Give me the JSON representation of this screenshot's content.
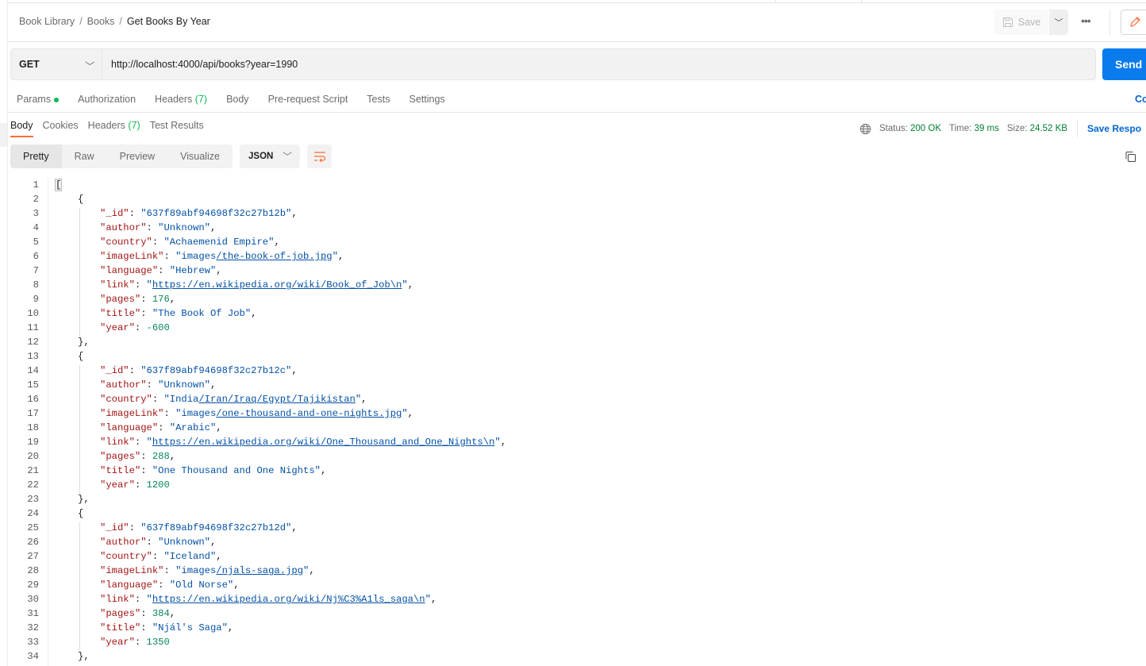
{
  "breadcrumb": {
    "items": [
      "Book Library",
      "Books"
    ],
    "current": "Get Books By Year"
  },
  "toolbar": {
    "save_label": "Save",
    "more_label": "•••"
  },
  "request": {
    "method": "GET",
    "url": "http://localhost:4000/api/books?year=1990",
    "send_label": "Send",
    "tabs": [
      {
        "label": "Params",
        "dot": true
      },
      {
        "label": "Authorization"
      },
      {
        "label": "Headers",
        "count": "(7)"
      },
      {
        "label": "Body"
      },
      {
        "label": "Pre-request Script"
      },
      {
        "label": "Tests"
      },
      {
        "label": "Settings"
      }
    ],
    "cookies_label": "Co"
  },
  "response": {
    "tabs": [
      {
        "label": "Body",
        "active": true
      },
      {
        "label": "Cookies"
      },
      {
        "label": "Headers",
        "count": "(7)"
      },
      {
        "label": "Test Results"
      }
    ],
    "status_label": "Status:",
    "status": "200 OK",
    "time_label": "Time:",
    "time": "39 ms",
    "size_label": "Size:",
    "size": "24.52 KB",
    "save_response_label": "Save Respo",
    "views": [
      "Pretty",
      "Raw",
      "Preview",
      "Visualize"
    ],
    "active_view": "Pretty",
    "format": "JSON",
    "books": [
      {
        "_id": "637f89abf94698f32c27b12b",
        "author": "Unknown",
        "country": "Achaemenid Empire",
        "imageLink": "images/the-book-of-job.jpg",
        "language": "Hebrew",
        "link": "https://en.wikipedia.org/wiki/Book_of_Job\\n",
        "pages": 176,
        "title": "The Book Of Job",
        "year": -600
      },
      {
        "_id": "637f89abf94698f32c27b12c",
        "author": "Unknown",
        "country": "India/Iran/Iraq/Egypt/Tajikistan",
        "imageLink": "images/one-thousand-and-one-nights.jpg",
        "language": "Arabic",
        "link": "https://en.wikipedia.org/wiki/One_Thousand_and_One_Nights\\n",
        "pages": 288,
        "title": "One Thousand and One Nights",
        "year": 1200
      },
      {
        "_id": "637f89abf94698f32c27b12d",
        "author": "Unknown",
        "country": "Iceland",
        "imageLink": "images/njals-saga.jpg",
        "language": "Old Norse",
        "link": "https://en.wikipedia.org/wiki/Nj%C3%A1ls_saga\\n",
        "pages": 384,
        "title": "Njál's Saga",
        "year": 1350
      }
    ]
  },
  "colors": {
    "accent": "#ff6c37",
    "send": "#097bed",
    "status_ok": "#007f31",
    "json_key": "#a31515",
    "json_string": "#0451a5",
    "json_number": "#098658"
  }
}
